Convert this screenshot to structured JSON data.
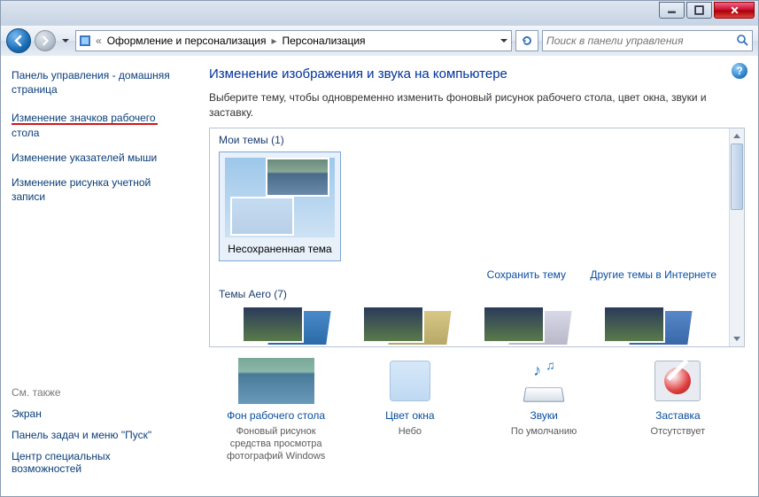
{
  "titlebar_buttons": {
    "min": "minimize",
    "max": "maximize",
    "close": "close"
  },
  "breadcrumb": {
    "prefix": "«",
    "parent": "Оформление и персонализация",
    "current": "Персонализация"
  },
  "search": {
    "placeholder": "Поиск в панели управления"
  },
  "sidebar": {
    "home": "Панель управления - домашняя страница",
    "tasks": [
      "Изменение значков рабочего стола",
      "Изменение указателей мыши",
      "Изменение рисунка учетной записи"
    ],
    "see_also_label": "См. также",
    "see_also": [
      "Экран",
      "Панель задач и меню \"Пуск\"",
      "Центр специальных возможностей"
    ]
  },
  "main": {
    "heading": "Изменение изображения и звука на компьютере",
    "desc": "Выберите тему, чтобы одновременно изменить фоновый рисунок рабочего стола, цвет окна, звуки и заставку.",
    "my_themes_label": "Мои темы (1)",
    "unsaved_theme": "Несохраненная тема",
    "save_theme": "Сохранить тему",
    "more_themes": "Другие темы в Интернете",
    "aero_label": "Темы Aero (7)"
  },
  "customize": {
    "bg": {
      "label": "Фон рабочего стола",
      "sub": "Фоновый рисунок средства просмотра фотографий Windows"
    },
    "color": {
      "label": "Цвет окна",
      "sub": "Небо"
    },
    "sound": {
      "label": "Звуки",
      "sub": "По умолчанию"
    },
    "saver": {
      "label": "Заставка",
      "sub": "Отсутствует"
    }
  }
}
